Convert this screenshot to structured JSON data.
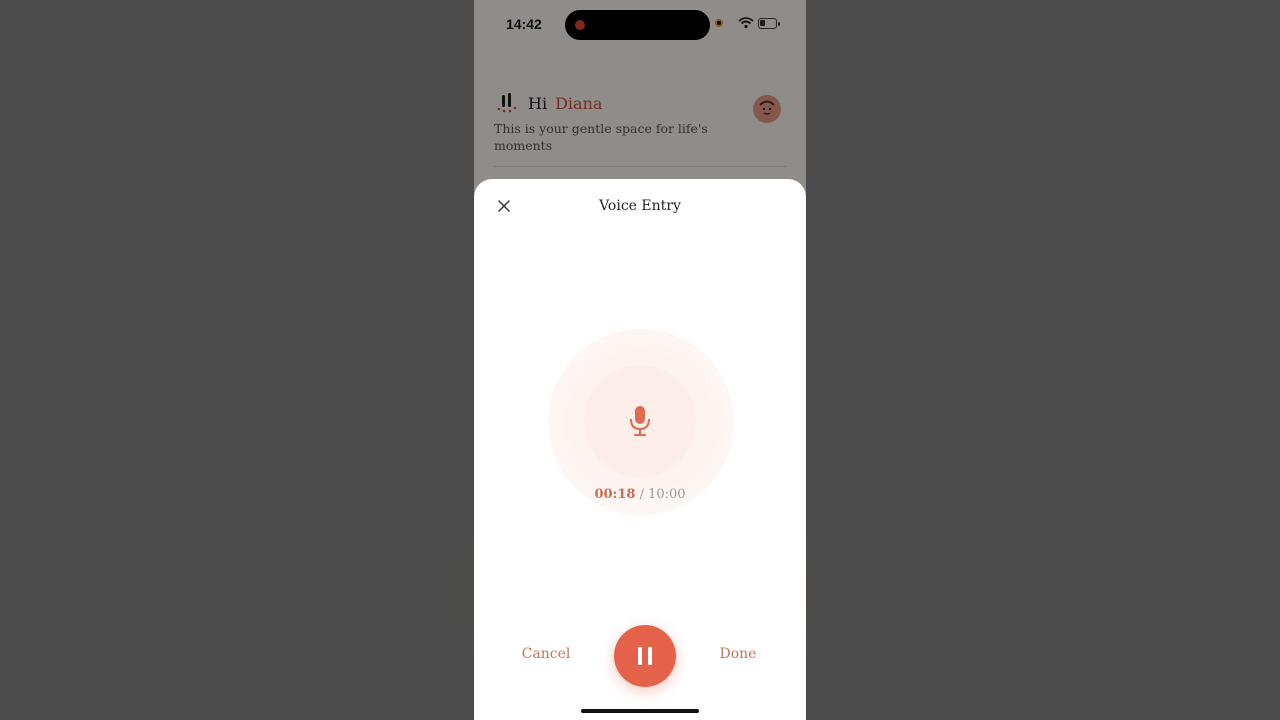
{
  "status_bar": {
    "time": "14:42"
  },
  "header": {
    "greeting": "Hi",
    "user_name": "Diana",
    "subtitle": "This is your gentle space for life's moments"
  },
  "sheet": {
    "title": "Voice Entry",
    "timer": {
      "elapsed": "00:18",
      "separator": "/",
      "total": "10:00"
    },
    "cancel_label": "Cancel",
    "done_label": "Done"
  },
  "icons": {
    "close": "close-icon",
    "mic": "microphone-icon",
    "pause": "pause-icon",
    "logo": "app-logo-icon",
    "avatar": "avatar"
  },
  "colors": {
    "accent": "#e4614a",
    "accent_text": "#c8735f",
    "name": "#c9523f",
    "mic_bg": "#fdeeea"
  }
}
